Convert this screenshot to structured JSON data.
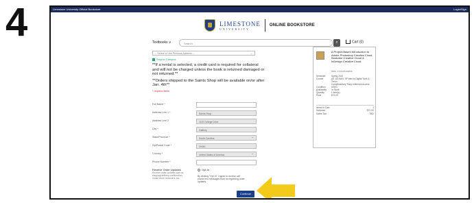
{
  "step_number": "4",
  "topbar": {
    "left": "Limestone University Official Bookstore",
    "right": "Login/Sign"
  },
  "brand": {
    "line1": "LIMESTONE",
    "line2": "UNIVERSITY",
    "store": "ONLINE BOOKSTORE"
  },
  "nav": {
    "textbooks": "Textbooks ∨",
    "search_placeholder": "Search",
    "cart": "Cart (0)"
  },
  "form": {
    "address_select": "-- Select to Use Previous Address --",
    "ship_to_campus": "Ship to Campus",
    "rental_notice": "**If a rental is selected, a credit card is required for collateral and will not be charged unless the book is returned damaged or not returned.**",
    "shipping_notice": "**Orders shipped to the Saints Shop will be available on/or after Jan. 4th**",
    "required_note": "* required fields",
    "fields": [
      {
        "label": "Full Name *",
        "value": ""
      },
      {
        "label": "Address Line 1 *",
        "value": "Saints Shop"
      },
      {
        "label": "Address Line 2",
        "value": "1115 College Drive"
      },
      {
        "label": "City *",
        "value": "Gaffney"
      },
      {
        "label": "State/Province *",
        "value": "South Carolina"
      },
      {
        "label": "Zip/Postal Code *",
        "value": "29340"
      },
      {
        "label": "Country *",
        "value": "United States of America"
      },
      {
        "label": "Phone Number *",
        "value": ""
      }
    ],
    "updates_label": "Receive Order Updates",
    "updates_desc": "Receive order updates such as shipping/delivery confirmation, rental return reminders, etc.",
    "optin_label": "Opt-In",
    "optin_text": "By clicking \"Opt-In\" I agree to receive cell phone text messages from us regarding order updates.",
    "continue": "Continue"
  },
  "summary": {
    "title": "A Project-Based Introduction to Adobe Photoshop Creative Cloud, Illustrator Creative Cloud & InDesign Creative Cloud",
    "isbn": "ISBN: 9781305499898",
    "meta": [
      {
        "k": "Semester",
        "v": "Spring 2022"
      },
      {
        "k": "Course",
        "v": "AR 116 5A01 SP Intro to Digital Tools & Techn"
      },
      {
        "k": "",
        "v": "Complimentary Tracy-Inferieres Access"
      },
      {
        "k": "Condition",
        "v": "USED"
      },
      {
        "k": "Availability",
        "v": "In Stock"
      },
      {
        "k": "Quantity",
        "v": "1 Item(s)"
      },
      {
        "k": "Price",
        "v": "$72.00"
      }
    ],
    "totals": [
      {
        "k": "Items in Cart:",
        "v": "1"
      },
      {
        "k": "Subtotal:",
        "v": "$72.00"
      },
      {
        "k": "Sales Tax:",
        "v": "TBD"
      }
    ]
  },
  "colors": {
    "brand": "#1b3f8a",
    "arrow": "#f3cc1b",
    "topbar": "#1b2c5a"
  }
}
